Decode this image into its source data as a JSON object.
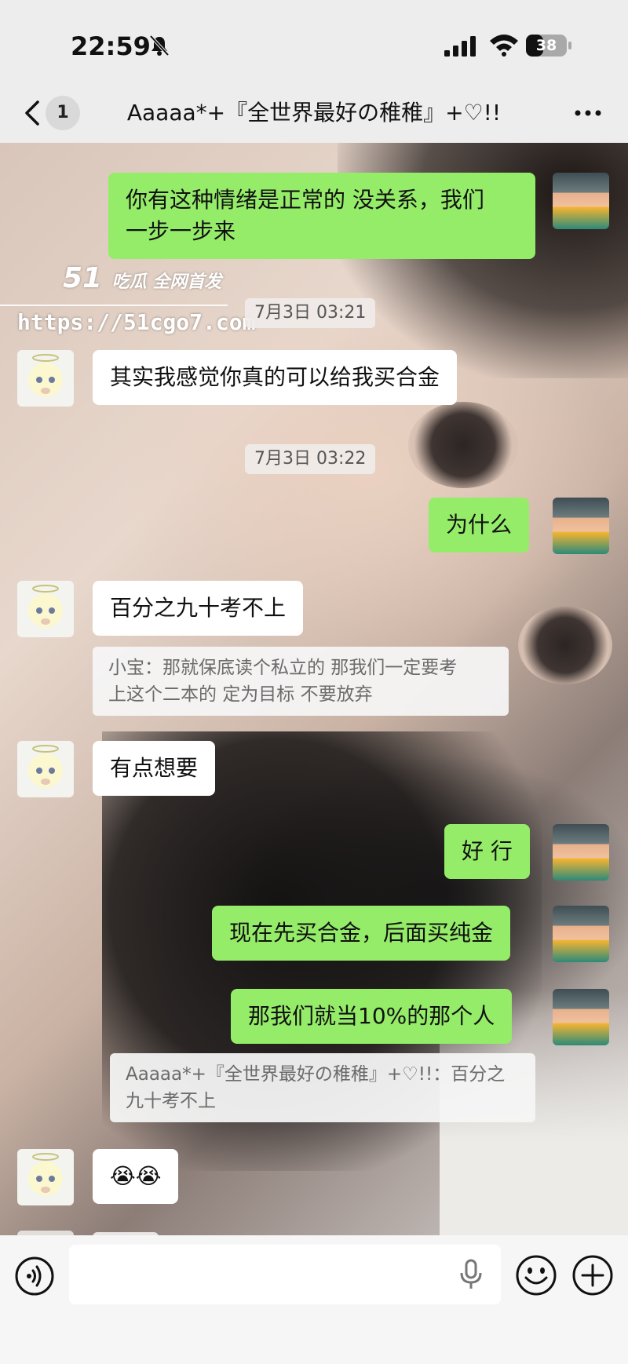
{
  "status_bar": {
    "time": "22:59",
    "battery": "38"
  },
  "header": {
    "unread_count": "1",
    "title": "Aaaaa*+『全世界最好の稚稚』+♡!!"
  },
  "watermark": {
    "logo": "51",
    "logo_text": "吃瓜 全网首发",
    "url": "https://51cgo7.com"
  },
  "messages": [
    {
      "side": "out",
      "text_lines": [
        "你有这种情绪是正常的 没关系，我们",
        "一步一步来"
      ]
    },
    {
      "type": "time",
      "text": "7月3日 03:21"
    },
    {
      "side": "in",
      "text": "其实我感觉你真的可以给我买合金"
    },
    {
      "type": "time",
      "text": "7月3日 03:22"
    },
    {
      "side": "out",
      "text": "为什么"
    },
    {
      "side": "in",
      "text": "百分之九十考不上"
    },
    {
      "type": "quote",
      "text_lines": [
        "小宝：那就保底读个私立的 那我们一定要考",
        "上这个二本的 定为目标 不要放弃"
      ]
    },
    {
      "side": "in",
      "text": "有点想要"
    },
    {
      "side": "out",
      "text": "好 行"
    },
    {
      "side": "out",
      "text": "现在先买合金，后面买纯金"
    },
    {
      "side": "out",
      "text": "那我们就当10%的那个人"
    },
    {
      "type": "quote",
      "text_lines": [
        "Aaaaa*+『全世界最好の稚稚』+♡!!：百分之",
        "九十考不上"
      ]
    },
    {
      "side": "in",
      "text": "😭😭"
    }
  ],
  "input": {
    "placeholder": ""
  },
  "colors": {
    "outgoing_bubble": "#95ec69",
    "incoming_bubble": "#ffffff",
    "background": "#ededed"
  },
  "icons": [
    "bell-mute-icon",
    "signal-icon",
    "wifi-icon",
    "battery-icon",
    "back-chevron-icon",
    "more-icon",
    "voice-icon",
    "mic-icon",
    "emoji-icon",
    "plus-icon"
  ]
}
